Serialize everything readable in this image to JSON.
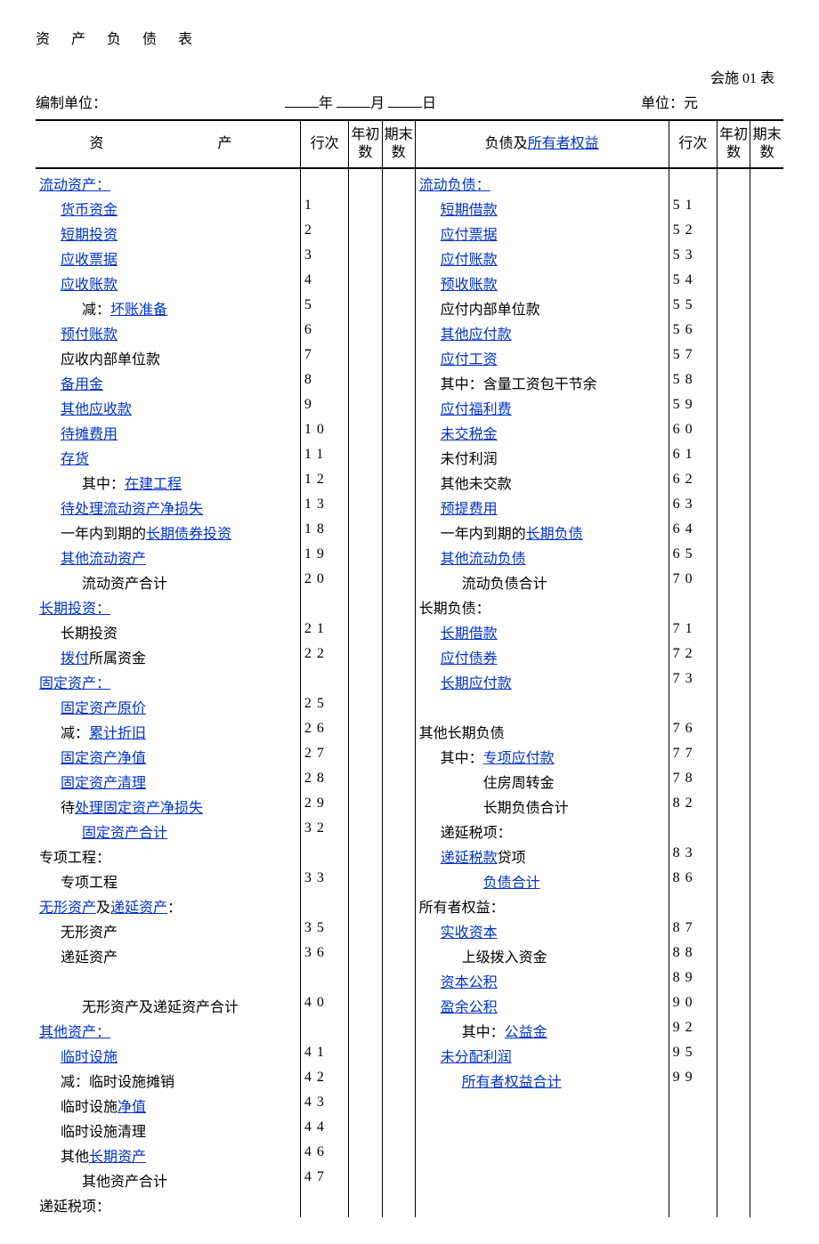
{
  "title": "资 产 负 债 表",
  "form_no": "会施 01 表",
  "unit_label": "编制单位：",
  "date_y": "年",
  "date_m": "月",
  "date_d": "日",
  "currency": "单位：元",
  "hdr_asset": "资　　产",
  "hdr_line": "行次",
  "hdr_begin": "年初数",
  "hdr_end": "期末数",
  "hdr_liab": "负债及",
  "hdr_liab_link": "所有者权益",
  "rows": [
    {
      "a": {
        "t": "流动资产：",
        "k": true
      },
      "la": "",
      "b": {
        "t": "流动负债：",
        "k": true
      },
      "lb": ""
    },
    {
      "a": {
        "t": "货币资金",
        "k": true,
        "i": 1
      },
      "la": "1",
      "b": {
        "t": "短期借款",
        "k": true,
        "i": 1
      },
      "lb": "51"
    },
    {
      "a": {
        "t": "短期投资",
        "k": true,
        "i": 1
      },
      "la": "2",
      "b": {
        "t": "应付票据",
        "k": true,
        "i": 1
      },
      "lb": "52"
    },
    {
      "a": {
        "t": "应收票据",
        "k": true,
        "i": 1
      },
      "la": "3",
      "b": {
        "t": "应付账款",
        "k": true,
        "i": 1
      },
      "lb": "53"
    },
    {
      "a": {
        "t": "应收账款",
        "k": true,
        "i": 1
      },
      "la": "4",
      "b": {
        "t": "预收账款",
        "k": true,
        "i": 1
      },
      "lb": "54"
    },
    {
      "a": {
        "pre": "减：",
        "t": "坏账准备",
        "k": true,
        "i": 2
      },
      "la": "5",
      "b": {
        "t": "应付内部单位款",
        "i": 1
      },
      "lb": "55"
    },
    {
      "a": {
        "t": "预付账款",
        "k": true,
        "i": 1
      },
      "la": "6",
      "b": {
        "t": "其他应付款",
        "k": true,
        "i": 1
      },
      "lb": "56"
    },
    {
      "a": {
        "t": "应收内部单位款",
        "i": 1
      },
      "la": "7",
      "b": {
        "t": "应付工资",
        "k": true,
        "i": 1
      },
      "lb": "57"
    },
    {
      "a": {
        "t": "备用金",
        "k": true,
        "i": 1
      },
      "la": "8",
      "b": {
        "t": "其中：含量工资包干节余",
        "i": 1
      },
      "lb": "58"
    },
    {
      "a": {
        "t": "其他应收款",
        "k": true,
        "i": 1
      },
      "la": "9",
      "b": {
        "t": "应付福利费",
        "k": true,
        "i": 1
      },
      "lb": "59"
    },
    {
      "a": {
        "t": "待摊费用",
        "k": true,
        "i": 1
      },
      "la": "10",
      "b": {
        "t": "未交税金",
        "k": true,
        "i": 1
      },
      "lb": "60"
    },
    {
      "a": {
        "t": "存货",
        "k": true,
        "i": 1
      },
      "la": "11",
      "b": {
        "t": "未付利润",
        "i": 1
      },
      "lb": "61"
    },
    {
      "a": {
        "pre": "其中：",
        "t": "在建工程",
        "k": true,
        "i": 2
      },
      "la": "12",
      "b": {
        "t": "其他未交款",
        "i": 1
      },
      "lb": "62"
    },
    {
      "a": {
        "t": "待处理流动资产净损失",
        "k": true,
        "i": 1
      },
      "la": "13",
      "b": {
        "t": "预提费用",
        "k": true,
        "i": 1
      },
      "lb": "63"
    },
    {
      "a": {
        "pre": "一年内到期的",
        "t": "长期债券投资",
        "k": true,
        "i": 1
      },
      "la": "18",
      "b": {
        "pre": "一年内到期的",
        "t": "长期负债",
        "k": true,
        "i": 1
      },
      "lb": "64"
    },
    {
      "a": {
        "t": "其他流动资产",
        "k": true,
        "i": 1
      },
      "la": "19",
      "b": {
        "t": "其他流动负债",
        "k": true,
        "i": 1
      },
      "lb": "65"
    },
    {
      "a": {
        "t": "流动资产合计",
        "i": 2
      },
      "la": "20",
      "b": {
        "t": "流动负债合计",
        "i": 2
      },
      "lb": "70"
    },
    {
      "a": {
        "t": "长期投资：",
        "k": true
      },
      "la": "",
      "b": {
        "t": "长期负债："
      },
      "lb": ""
    },
    {
      "a": {
        "t": "长期投资",
        "i": 1
      },
      "la": "21",
      "b": {
        "t": "长期借款",
        "k": true,
        "i": 1
      },
      "lb": "71"
    },
    {
      "a": {
        "pre": "",
        "t": "拨付",
        "k": true,
        "post": "所属资金",
        "i": 1
      },
      "la": "22",
      "b": {
        "t": "应付债券",
        "k": true,
        "i": 1
      },
      "lb": "72"
    },
    {
      "a": {
        "t": "固定资产：",
        "k": true
      },
      "la": "",
      "b": {
        "t": "长期应付款",
        "k": true,
        "i": 1
      },
      "lb": "73"
    },
    {
      "a": {
        "t": "固定资产原价",
        "k": true,
        "i": 1
      },
      "la": "25",
      "b": {
        "t": ""
      },
      "lb": ""
    },
    {
      "a": {
        "pre": "减：",
        "t": "累计折旧",
        "k": true,
        "i": 1
      },
      "la": "26",
      "b": {
        "t": "其他长期负债"
      },
      "lb": "76"
    },
    {
      "a": {
        "t": "固定资产净值",
        "k": true,
        "i": 1
      },
      "la": "27",
      "b": {
        "pre": "其中：",
        "t": "专项应付款",
        "k": true,
        "i": 1
      },
      "lb": "77"
    },
    {
      "a": {
        "t": "固定资产清理",
        "k": true,
        "i": 1
      },
      "la": "28",
      "b": {
        "t": "住房周转金",
        "i": 3
      },
      "lb": "78"
    },
    {
      "a": {
        "pre": "待",
        "t": "处理固定资产净损失",
        "k": true,
        "i": 1
      },
      "la": "29",
      "b": {
        "t": "长期负债合计",
        "i": 3
      },
      "lb": "82"
    },
    {
      "a": {
        "t": "固定资产合计",
        "k": true,
        "i": 2
      },
      "la": "32",
      "b": {
        "t": "递延税项：",
        "i": 1
      },
      "lb": ""
    },
    {
      "a": {
        "t": "专项工程："
      },
      "la": "",
      "b": {
        "pre": "",
        "t": "递延税款",
        "k": true,
        "post": "贷项",
        "i": 1
      },
      "lb": "83"
    },
    {
      "a": {
        "t": "专项工程",
        "i": 1
      },
      "la": "33",
      "b": {
        "t": "负债合计",
        "k": true,
        "i": 3
      },
      "lb": "86"
    },
    {
      "a": {
        "parts": [
          {
            "t": "无形资产",
            "k": true
          },
          {
            "t": "及"
          },
          {
            "t": "递延资产",
            "k": true
          },
          {
            "t": "："
          }
        ]
      },
      "la": "",
      "b": {
        "t": "所有者权益："
      },
      "lb": ""
    },
    {
      "a": {
        "t": "无形资产",
        "i": 1
      },
      "la": "35",
      "b": {
        "t": "实收资本",
        "k": true,
        "i": 1
      },
      "lb": "87"
    },
    {
      "a": {
        "t": "递延资产",
        "i": 1
      },
      "la": "36",
      "b": {
        "t": "上级拨入资金",
        "i": 2
      },
      "lb": "88"
    },
    {
      "a": {
        "t": ""
      },
      "la": "",
      "b": {
        "t": "资本公积",
        "k": true,
        "i": 1
      },
      "lb": "89"
    },
    {
      "a": {
        "t": "无形资产及递延资产合计",
        "i": 2
      },
      "la": "40",
      "b": {
        "t": "盈余公积",
        "k": true,
        "i": 1
      },
      "lb": "90"
    },
    {
      "a": {
        "t": "其他资产：",
        "k": true
      },
      "la": "",
      "b": {
        "pre": "其中：",
        "t": "公益金",
        "k": true,
        "i": 2
      },
      "lb": "92"
    },
    {
      "a": {
        "t": "临时设施",
        "k": true,
        "i": 1
      },
      "la": "41",
      "b": {
        "t": "未分配利润",
        "k": true,
        "i": 1
      },
      "lb": "95"
    },
    {
      "a": {
        "t": "减：临时设施摊销",
        "i": 1
      },
      "la": "42",
      "b": {
        "t": "所有者权益合计",
        "k": true,
        "i": 2
      },
      "lb": "99"
    },
    {
      "a": {
        "pre": "临时设施",
        "t": "净值",
        "k": true,
        "i": 1
      },
      "la": "43",
      "b": {
        "t": ""
      },
      "lb": ""
    },
    {
      "a": {
        "t": "临时设施清理",
        "i": 1
      },
      "la": "44",
      "b": {
        "t": ""
      },
      "lb": ""
    },
    {
      "a": {
        "pre": "其他",
        "t": "长期资产",
        "k": true,
        "i": 1
      },
      "la": "46",
      "b": {
        "t": ""
      },
      "lb": ""
    },
    {
      "a": {
        "t": "其他资产合计",
        "i": 2
      },
      "la": "47",
      "b": {
        "t": ""
      },
      "lb": ""
    },
    {
      "a": {
        "t": "递延税项："
      },
      "la": "",
      "b": {
        "t": ""
      },
      "lb": ""
    }
  ]
}
